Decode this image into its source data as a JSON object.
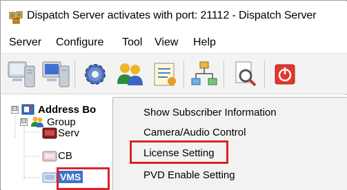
{
  "window": {
    "title": "Dispatch Server activates with port: 21112 - Dispatch Server",
    "icon": "dispatch-server-app-icon"
  },
  "menubar": {
    "items": [
      "Server",
      "Configure",
      "Tool",
      "View",
      "Help"
    ]
  },
  "toolbar": {
    "buttons": [
      {
        "icon": "server-computer-icon"
      },
      {
        "icon": "client-computer-icon"
      },
      {
        "icon": "gear-settings-icon"
      },
      {
        "icon": "users-group-icon"
      },
      {
        "icon": "notepad-list-icon"
      },
      {
        "icon": "network-tree-icon"
      },
      {
        "icon": "document-search-icon"
      },
      {
        "icon": "power-stop-icon"
      }
    ]
  },
  "tree": {
    "root": {
      "label": "Address Bo",
      "expander": "⊟"
    },
    "group": {
      "label": "Group",
      "expander": "⊟"
    },
    "children": [
      {
        "label": "Serv"
      },
      {
        "label": "CB"
      },
      {
        "label": "VMS",
        "selected": true
      }
    ]
  },
  "context_menu": {
    "items": [
      {
        "label": "Show Subscriber Information"
      },
      {
        "label": "Camera/Audio Control"
      },
      {
        "label": "License Setting",
        "highlighted": true
      },
      {
        "label": "PVD Enable Setting"
      }
    ]
  },
  "colors": {
    "highlight_box": "#e0202a",
    "selection": "#3b73c8"
  }
}
